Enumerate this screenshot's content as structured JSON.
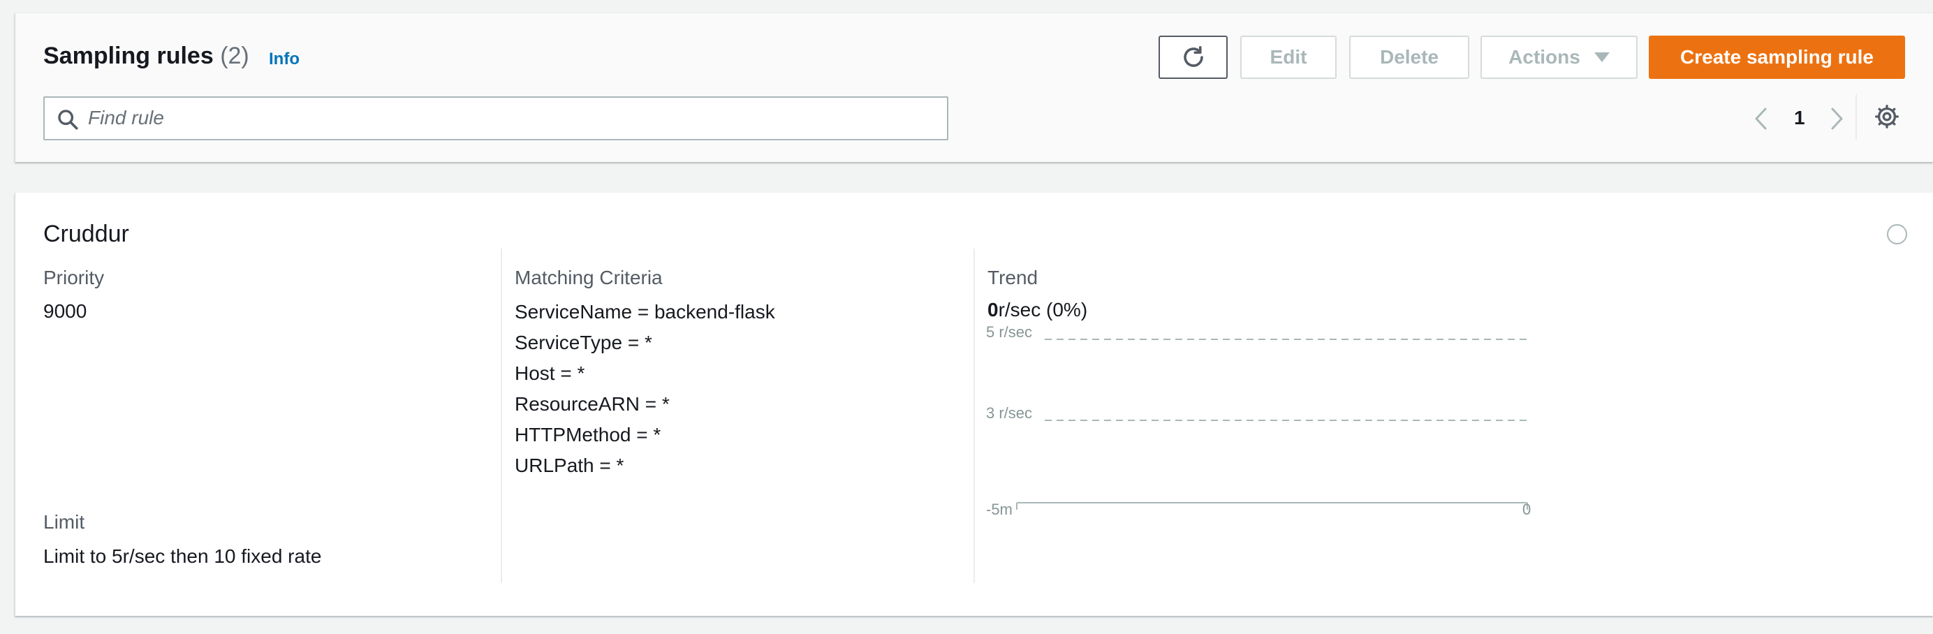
{
  "header": {
    "title": "Sampling rules",
    "count": "(2)",
    "info_link": "Info",
    "buttons": {
      "refresh_icon": "refresh-icon",
      "edit": "Edit",
      "delete": "Delete",
      "actions": "Actions",
      "create": "Create sampling rule"
    },
    "search": {
      "placeholder": "Find rule",
      "value": ""
    },
    "pagination": {
      "current_page": "1"
    }
  },
  "rule": {
    "name": "Cruddur",
    "priority_label": "Priority",
    "priority": "9000",
    "limit_label": "Limit",
    "limit": "Limit to 5r/sec then 10 fixed rate",
    "criteria_label": "Matching Criteria",
    "criteria": [
      "ServiceName = backend-flask",
      "ServiceType = *",
      "Host = *",
      "ResourceARN = *",
      "HTTPMethod = *",
      "URLPath = *"
    ],
    "trend_label": "Trend",
    "trend_rate": "0",
    "trend_rest": "r/sec (0%)",
    "chart": {
      "y_labels": [
        "5 r/sec",
        "3 r/sec"
      ],
      "x_start": "-5m",
      "x_end": "0"
    }
  },
  "colors": {
    "primary": "#ec7211",
    "link": "#0073bb",
    "disabled_text": "#aab7b8"
  }
}
